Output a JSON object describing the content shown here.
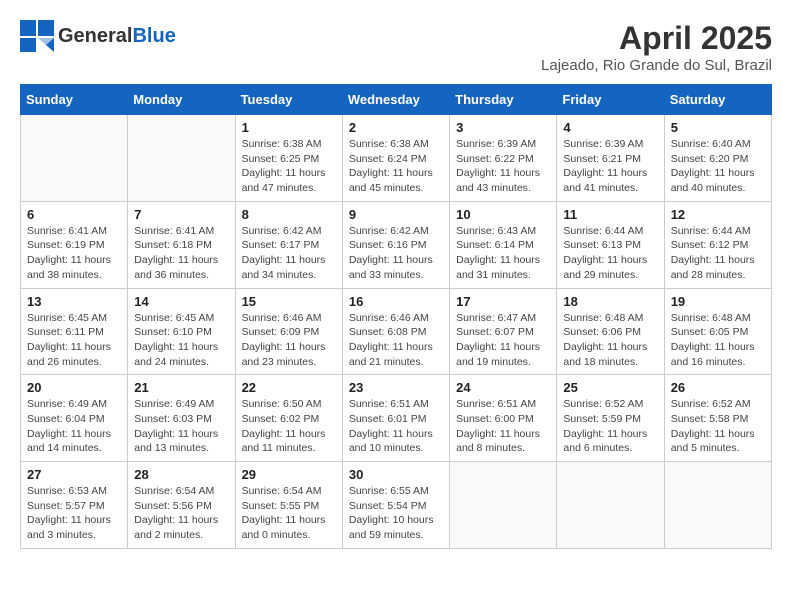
{
  "header": {
    "logo_line1": "General",
    "logo_line2": "Blue",
    "month": "April 2025",
    "location": "Lajeado, Rio Grande do Sul, Brazil"
  },
  "days_of_week": [
    "Sunday",
    "Monday",
    "Tuesday",
    "Wednesday",
    "Thursday",
    "Friday",
    "Saturday"
  ],
  "weeks": [
    [
      {
        "day": "",
        "info": ""
      },
      {
        "day": "",
        "info": ""
      },
      {
        "day": "1",
        "info": "Sunrise: 6:38 AM\nSunset: 6:25 PM\nDaylight: 11 hours and 47 minutes."
      },
      {
        "day": "2",
        "info": "Sunrise: 6:38 AM\nSunset: 6:24 PM\nDaylight: 11 hours and 45 minutes."
      },
      {
        "day": "3",
        "info": "Sunrise: 6:39 AM\nSunset: 6:22 PM\nDaylight: 11 hours and 43 minutes."
      },
      {
        "day": "4",
        "info": "Sunrise: 6:39 AM\nSunset: 6:21 PM\nDaylight: 11 hours and 41 minutes."
      },
      {
        "day": "5",
        "info": "Sunrise: 6:40 AM\nSunset: 6:20 PM\nDaylight: 11 hours and 40 minutes."
      }
    ],
    [
      {
        "day": "6",
        "info": "Sunrise: 6:41 AM\nSunset: 6:19 PM\nDaylight: 11 hours and 38 minutes."
      },
      {
        "day": "7",
        "info": "Sunrise: 6:41 AM\nSunset: 6:18 PM\nDaylight: 11 hours and 36 minutes."
      },
      {
        "day": "8",
        "info": "Sunrise: 6:42 AM\nSunset: 6:17 PM\nDaylight: 11 hours and 34 minutes."
      },
      {
        "day": "9",
        "info": "Sunrise: 6:42 AM\nSunset: 6:16 PM\nDaylight: 11 hours and 33 minutes."
      },
      {
        "day": "10",
        "info": "Sunrise: 6:43 AM\nSunset: 6:14 PM\nDaylight: 11 hours and 31 minutes."
      },
      {
        "day": "11",
        "info": "Sunrise: 6:44 AM\nSunset: 6:13 PM\nDaylight: 11 hours and 29 minutes."
      },
      {
        "day": "12",
        "info": "Sunrise: 6:44 AM\nSunset: 6:12 PM\nDaylight: 11 hours and 28 minutes."
      }
    ],
    [
      {
        "day": "13",
        "info": "Sunrise: 6:45 AM\nSunset: 6:11 PM\nDaylight: 11 hours and 26 minutes."
      },
      {
        "day": "14",
        "info": "Sunrise: 6:45 AM\nSunset: 6:10 PM\nDaylight: 11 hours and 24 minutes."
      },
      {
        "day": "15",
        "info": "Sunrise: 6:46 AM\nSunset: 6:09 PM\nDaylight: 11 hours and 23 minutes."
      },
      {
        "day": "16",
        "info": "Sunrise: 6:46 AM\nSunset: 6:08 PM\nDaylight: 11 hours and 21 minutes."
      },
      {
        "day": "17",
        "info": "Sunrise: 6:47 AM\nSunset: 6:07 PM\nDaylight: 11 hours and 19 minutes."
      },
      {
        "day": "18",
        "info": "Sunrise: 6:48 AM\nSunset: 6:06 PM\nDaylight: 11 hours and 18 minutes."
      },
      {
        "day": "19",
        "info": "Sunrise: 6:48 AM\nSunset: 6:05 PM\nDaylight: 11 hours and 16 minutes."
      }
    ],
    [
      {
        "day": "20",
        "info": "Sunrise: 6:49 AM\nSunset: 6:04 PM\nDaylight: 11 hours and 14 minutes."
      },
      {
        "day": "21",
        "info": "Sunrise: 6:49 AM\nSunset: 6:03 PM\nDaylight: 11 hours and 13 minutes."
      },
      {
        "day": "22",
        "info": "Sunrise: 6:50 AM\nSunset: 6:02 PM\nDaylight: 11 hours and 11 minutes."
      },
      {
        "day": "23",
        "info": "Sunrise: 6:51 AM\nSunset: 6:01 PM\nDaylight: 11 hours and 10 minutes."
      },
      {
        "day": "24",
        "info": "Sunrise: 6:51 AM\nSunset: 6:00 PM\nDaylight: 11 hours and 8 minutes."
      },
      {
        "day": "25",
        "info": "Sunrise: 6:52 AM\nSunset: 5:59 PM\nDaylight: 11 hours and 6 minutes."
      },
      {
        "day": "26",
        "info": "Sunrise: 6:52 AM\nSunset: 5:58 PM\nDaylight: 11 hours and 5 minutes."
      }
    ],
    [
      {
        "day": "27",
        "info": "Sunrise: 6:53 AM\nSunset: 5:57 PM\nDaylight: 11 hours and 3 minutes."
      },
      {
        "day": "28",
        "info": "Sunrise: 6:54 AM\nSunset: 5:56 PM\nDaylight: 11 hours and 2 minutes."
      },
      {
        "day": "29",
        "info": "Sunrise: 6:54 AM\nSunset: 5:55 PM\nDaylight: 11 hours and 0 minutes."
      },
      {
        "day": "30",
        "info": "Sunrise: 6:55 AM\nSunset: 5:54 PM\nDaylight: 10 hours and 59 minutes."
      },
      {
        "day": "",
        "info": ""
      },
      {
        "day": "",
        "info": ""
      },
      {
        "day": "",
        "info": ""
      }
    ]
  ]
}
